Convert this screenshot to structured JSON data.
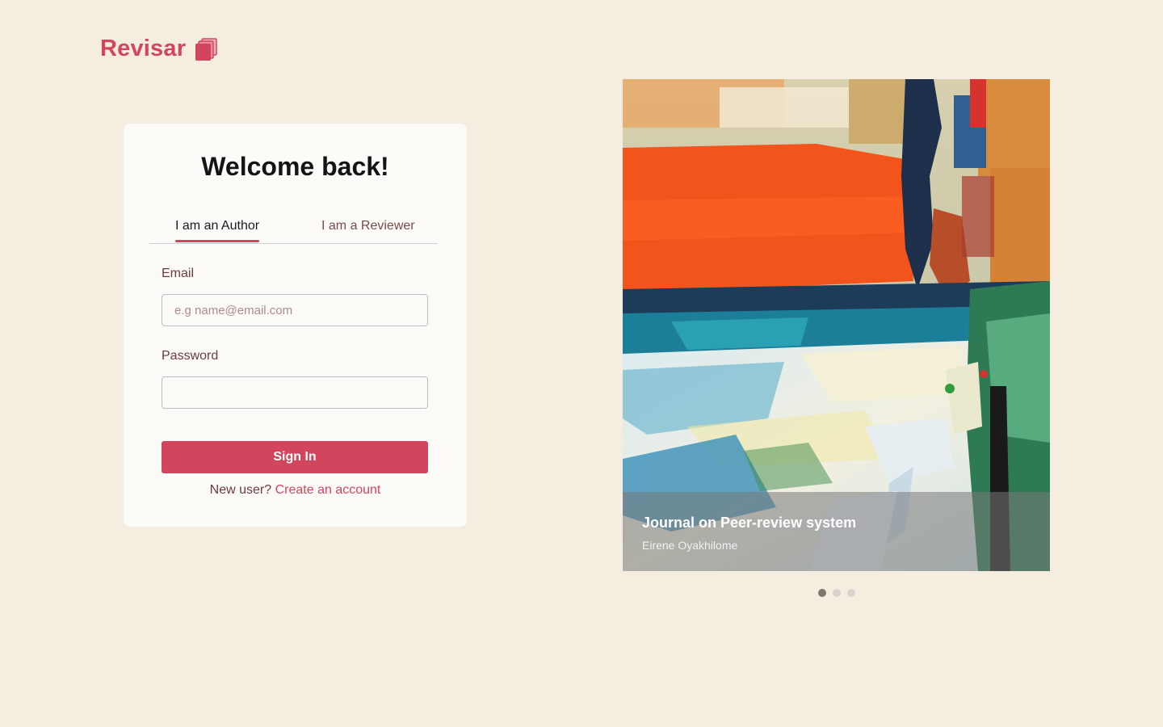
{
  "brand": {
    "name": "Revisar",
    "icon": "stacked-pages-icon",
    "color": "#d1465d"
  },
  "login": {
    "title": "Welcome back!",
    "tabs": [
      {
        "label": "I am an Author",
        "active": true
      },
      {
        "label": "I am a Reviewer",
        "active": false
      }
    ],
    "email": {
      "label": "Email",
      "placeholder": "e.g name@email.com",
      "value": ""
    },
    "password": {
      "label": "Password",
      "value": ""
    },
    "submit_label": "Sign In",
    "signup_prompt": "New user?",
    "signup_link": "Create an account"
  },
  "carousel": {
    "slide": {
      "title": "Journal on Peer-review system",
      "author": "Eirene Oyakhilome"
    },
    "slide_count": 3,
    "active_index": 0
  },
  "colors": {
    "background": "#f5ede0",
    "card": "#fcfbf7",
    "accent": "#d1465d"
  }
}
